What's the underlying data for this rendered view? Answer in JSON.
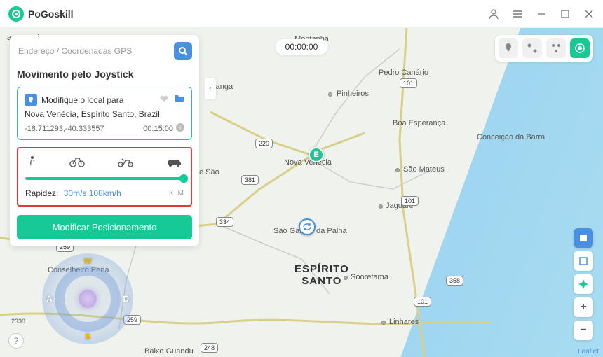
{
  "app": {
    "name": "PoGoskill"
  },
  "search": {
    "placeholder": "Endereço / Coordenadas GPS"
  },
  "panel": {
    "title": "Movimento pelo Joystick",
    "modify_label": "Modifique o local para",
    "location_name": "Nova Venécia, Espírito Santo, Brazil",
    "coords": "-18.711293,-40.333557",
    "duration": "00:15:00",
    "speed_label": "Rapidez:",
    "speed_value": "30m/s 108km/h",
    "unit_k": "K",
    "unit_m": "M",
    "go_button": "Modificar Posicionamento"
  },
  "timer": "00:00:00",
  "joystick": {
    "w": "W",
    "a": "A",
    "s": "S",
    "d": "D"
  },
  "map": {
    "region_line1": "ESPÍRITO",
    "region_line2": "SANTO",
    "labels": {
      "montanha": "Montanha",
      "pedro_canario": "Pedro Canário",
      "pinheiros": "Pinheiros",
      "boa_esperanca": "Boa Esperança",
      "conceicao": "Conceição da Barra",
      "nova_venecia": "Nova Venecia",
      "sao_mateus": "São Mateus",
      "jaguare": "Jaguaré",
      "sao_gabriel": "São Gabriel da Palha",
      "sooretama": "Sooretama",
      "linhares": "Linhares",
      "baixo_guandu": "Baixo Guandu",
      "conselheiro": "Conselheiro Pena",
      "ranga": "ranga",
      "e_sao": "e São",
      "ampanario": "ampanario"
    },
    "routes": {
      "r101a": "101",
      "r101b": "101",
      "r101c": "101",
      "r381": "381",
      "r220": "220",
      "r259a": "259",
      "r259b": "259",
      "r334": "334",
      "r358": "358",
      "r248": "248"
    },
    "marker_e": "E",
    "leaflet": "Leaflet",
    "scale": "2330"
  },
  "controls": {
    "plus": "+",
    "minus": "−"
  },
  "help": "?"
}
